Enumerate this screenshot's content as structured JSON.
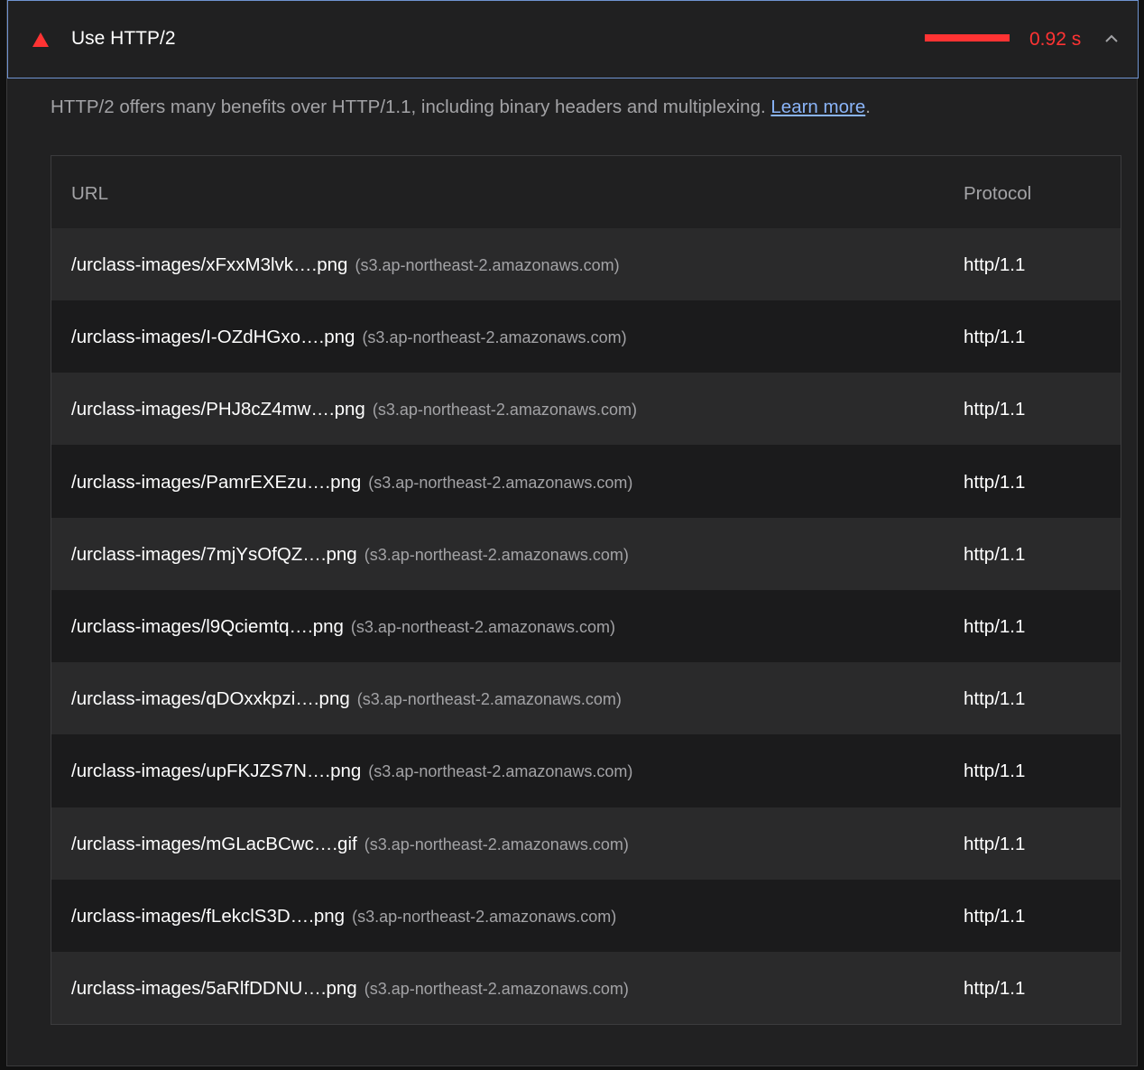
{
  "audit": {
    "title": "Use HTTP/2",
    "savings": "0.92 s",
    "description": "HTTP/2 offers many benefits over HTTP/1.1, including binary headers and multiplexing.",
    "learn_more": "Learn more",
    "period": ".",
    "status_color": "#ff3333",
    "icon": "warning-triangle-icon",
    "toggle_icon": "chevron-up-icon"
  },
  "table": {
    "headers": {
      "url": "URL",
      "protocol": "Protocol"
    },
    "rows": [
      {
        "path": "/urclass-images/xFxxM3lvk….png",
        "host": "(s3.ap-northeast-2.amazonaws.com)",
        "protocol": "http/1.1"
      },
      {
        "path": "/urclass-images/I-OZdHGxo….png",
        "host": "(s3.ap-northeast-2.amazonaws.com)",
        "protocol": "http/1.1"
      },
      {
        "path": "/urclass-images/PHJ8cZ4mw….png",
        "host": "(s3.ap-northeast-2.amazonaws.com)",
        "protocol": "http/1.1"
      },
      {
        "path": "/urclass-images/PamrEXEzu….png",
        "host": "(s3.ap-northeast-2.amazonaws.com)",
        "protocol": "http/1.1"
      },
      {
        "path": "/urclass-images/7mjYsOfQZ….png",
        "host": "(s3.ap-northeast-2.amazonaws.com)",
        "protocol": "http/1.1"
      },
      {
        "path": "/urclass-images/l9Qciemtq….png",
        "host": "(s3.ap-northeast-2.amazonaws.com)",
        "protocol": "http/1.1"
      },
      {
        "path": "/urclass-images/qDOxxkpzi….png",
        "host": "(s3.ap-northeast-2.amazonaws.com)",
        "protocol": "http/1.1"
      },
      {
        "path": "/urclass-images/upFKJZS7N….png",
        "host": "(s3.ap-northeast-2.amazonaws.com)",
        "protocol": "http/1.1"
      },
      {
        "path": "/urclass-images/mGLacBCwc….gif",
        "host": "(s3.ap-northeast-2.amazonaws.com)",
        "protocol": "http/1.1"
      },
      {
        "path": "/urclass-images/fLekclS3D….png",
        "host": "(s3.ap-northeast-2.amazonaws.com)",
        "protocol": "http/1.1"
      },
      {
        "path": "/urclass-images/5aRlfDDNU….png",
        "host": "(s3.ap-northeast-2.amazonaws.com)",
        "protocol": "http/1.1"
      }
    ]
  }
}
